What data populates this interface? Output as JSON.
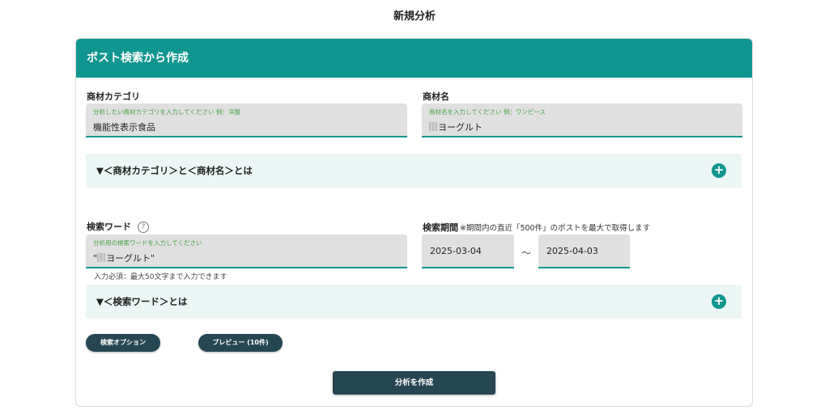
{
  "page": {
    "title": "新規分析"
  },
  "card": {
    "header": "ポスト検索から作成",
    "category": {
      "label": "商材カテゴリ",
      "placeholder": "分析したい商材カテゴリを入力してください 例：洋服",
      "value": "機能性表示食品"
    },
    "product": {
      "label": "商材名",
      "placeholder": "商材名を入力してください 例：ワンピース",
      "value": "ヨーグルト"
    },
    "explain1": {
      "title": "▼＜商材カテゴリ＞と＜商材名＞とは",
      "icon": "plus-circle-icon"
    },
    "keyword": {
      "label": "検索ワード",
      "help": "?",
      "placeholder": "分析用の検索ワードを入力してください",
      "value_prefix": "\"",
      "value": "ヨーグルト\"",
      "hint": "入力必須：最大50文字まで入力できます"
    },
    "period": {
      "label": "検索期間",
      "note": "※期間内の直近「500件」のポストを最大で取得します",
      "start": "2025-03-04",
      "separator": "～",
      "end": "2025-04-03"
    },
    "explain2": {
      "title": "▼＜検索ワード＞とは",
      "icon": "plus-circle-icon"
    },
    "buttons": {
      "search_options": "検索オプション",
      "preview": "プレビュー (10件)",
      "create": "分析を作成"
    }
  },
  "colors": {
    "accent": "#0f9690",
    "button": "#264653",
    "panel": "#ebf6f5",
    "placeholder": "#44a043"
  }
}
